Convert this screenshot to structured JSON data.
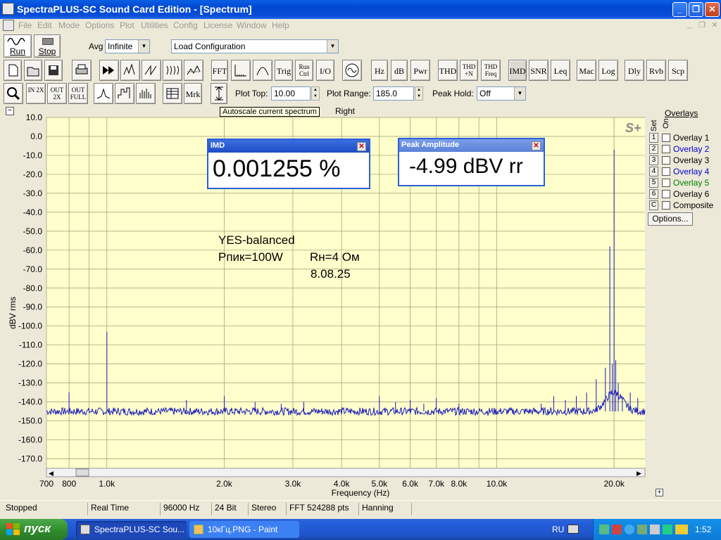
{
  "window": {
    "title": "SpectraPLUS-SC Sound Card Edition - [Spectrum]",
    "minimize": "_",
    "restore": "❐",
    "close": "✕"
  },
  "menu": [
    "File",
    "Edit",
    "Mode",
    "Options",
    "Plot",
    "Utilities",
    "Config",
    "License",
    "Window",
    "Help"
  ],
  "mdi": {
    "minimize": "_",
    "restore": "❐",
    "close": "✕"
  },
  "toolbar1": {
    "run": "Run",
    "stop": "Stop",
    "avg_label": "Avg",
    "avg_value": "Infinite",
    "config_value": "Load Configuration"
  },
  "toolbar2": {
    "buttons": [
      "FFT",
      "Trig",
      "Run Ctrl",
      "I/O",
      "Hz",
      "dB",
      "Pwr",
      "THD",
      "THD +N",
      "THD Freq",
      "IMD",
      "SNR",
      "Leq",
      "Mac",
      "Log",
      "Dly",
      "Rvb",
      "Scp"
    ]
  },
  "toolbar3": {
    "mrk": "Mrk",
    "plot_top_label": "Plot Top:",
    "plot_top_value": "10.00",
    "plot_range_label": "Plot Range:",
    "plot_range_value": "185.0",
    "peak_hold_label": "Peak Hold:",
    "peak_hold_value": "Off",
    "zoom_in": "IN 2X",
    "zoom_out": "OUT 2X",
    "zoom_full": "OUT FULL"
  },
  "plot": {
    "collapse": "−",
    "tooltip": "Autoscale current spectrum",
    "channel": "Right",
    "logo": "S+",
    "expand": "+",
    "annotation": [
      "YES-balanced",
      "Рпик=100W",
      "Rн=4 Ом",
      "8.08.25"
    ]
  },
  "meters": {
    "imd": {
      "title": "IMD",
      "value": "0.001255 %"
    },
    "peak": {
      "title": "Peak Amplitude",
      "value": "-4.99 dBV rr"
    }
  },
  "overlays": {
    "title": "Overlays",
    "set_label": "Set",
    "on_label": "On",
    "items": [
      {
        "num": "1",
        "label": "Overlay 1",
        "color": "#000000"
      },
      {
        "num": "2",
        "label": "Overlay 2",
        "color": "#0000cc"
      },
      {
        "num": "3",
        "label": "Overlay 3",
        "color": "#000000"
      },
      {
        "num": "4",
        "label": "Overlay 4",
        "color": "#0000cc"
      },
      {
        "num": "5",
        "label": "Overlay 5",
        "color": "#008000"
      },
      {
        "num": "6",
        "label": "Overlay 6",
        "color": "#000000"
      },
      {
        "num": "C",
        "label": "Composite",
        "color": "#000000"
      }
    ],
    "options_button": "Options..."
  },
  "status": [
    "Stopped",
    "Real Time",
    "96000 Hz",
    "24 Bit",
    "Stereo",
    "FFT 524288 pts",
    "Hanning"
  ],
  "taskbar": {
    "start": "пуск",
    "tasks": [
      "SpectraPLUS-SC Sou...",
      "10кГц.PNG - Paint"
    ],
    "lang": "RU",
    "clock": "1:52"
  },
  "chart_data": {
    "type": "line",
    "xlabel": "Frequency (Hz)",
    "ylabel": "dBV rms",
    "xscale": "log",
    "xlim": [
      700,
      24000
    ],
    "ylim": [
      -175,
      10
    ],
    "x_ticks": [
      "700",
      "800",
      "1.0k",
      "2.0k",
      "3.0k",
      "4.0k",
      "5.0k",
      "6.0k",
      "7.0k",
      "8.0k",
      "10.0k",
      "20.0k"
    ],
    "x_tick_values": [
      700,
      800,
      1000,
      2000,
      3000,
      4000,
      5000,
      6000,
      7000,
      8000,
      10000,
      20000
    ],
    "y_ticks": [
      "10.0",
      "0.0",
      "-10.0",
      "-20.0",
      "-30.0",
      "-40.0",
      "-50.0",
      "-60.0",
      "-70.0",
      "-80.0",
      "-90.0",
      "-100.0",
      "-110.0",
      "-120.0",
      "-130.0",
      "-140.0",
      "-150.0",
      "-160.0",
      "-170.0"
    ],
    "y_tick_values": [
      10,
      0,
      -10,
      -20,
      -30,
      -40,
      -50,
      -60,
      -70,
      -80,
      -90,
      -100,
      -110,
      -120,
      -130,
      -140,
      -150,
      -160,
      -170
    ],
    "grid": true,
    "series": [
      {
        "color": "#1a1ab8",
        "floor": -145,
        "points": [
          [
            700,
            -145
          ],
          [
            720,
            -143
          ],
          [
            760,
            -146
          ],
          [
            800,
            -135
          ],
          [
            820,
            -145
          ],
          [
            880,
            -143
          ],
          [
            940,
            -146
          ],
          [
            1000,
            -103
          ],
          [
            1050,
            -145
          ],
          [
            1200,
            -144
          ],
          [
            1400,
            -146
          ],
          [
            1600,
            -139
          ],
          [
            1800,
            -145
          ],
          [
            2000,
            -137
          ],
          [
            2200,
            -145
          ],
          [
            2400,
            -140
          ],
          [
            2600,
            -146
          ],
          [
            2800,
            -141
          ],
          [
            3000,
            -145
          ],
          [
            3200,
            -140
          ],
          [
            3500,
            -145
          ],
          [
            3800,
            -146
          ],
          [
            4000,
            -142
          ],
          [
            4400,
            -145
          ],
          [
            4800,
            -144
          ],
          [
            5000,
            -137
          ],
          [
            5200,
            -145
          ],
          [
            5500,
            -140
          ],
          [
            6000,
            -139
          ],
          [
            6500,
            -141
          ],
          [
            7000,
            -138
          ],
          [
            7500,
            -142
          ],
          [
            8000,
            -141
          ],
          [
            9000,
            -144
          ],
          [
            10000,
            -144
          ],
          [
            12000,
            -144
          ],
          [
            13000,
            -141
          ],
          [
            14000,
            -137
          ],
          [
            15000,
            -139
          ],
          [
            16000,
            -137
          ],
          [
            17000,
            -135
          ],
          [
            18000,
            -128
          ],
          [
            19000,
            -122
          ],
          [
            19500,
            -58
          ],
          [
            19800,
            -120
          ],
          [
            20000,
            -7
          ],
          [
            20200,
            -118
          ],
          [
            20500,
            -130
          ],
          [
            21000,
            -138
          ],
          [
            22000,
            -135
          ],
          [
            23000,
            -138
          ],
          [
            24000,
            -145
          ]
        ]
      }
    ]
  }
}
